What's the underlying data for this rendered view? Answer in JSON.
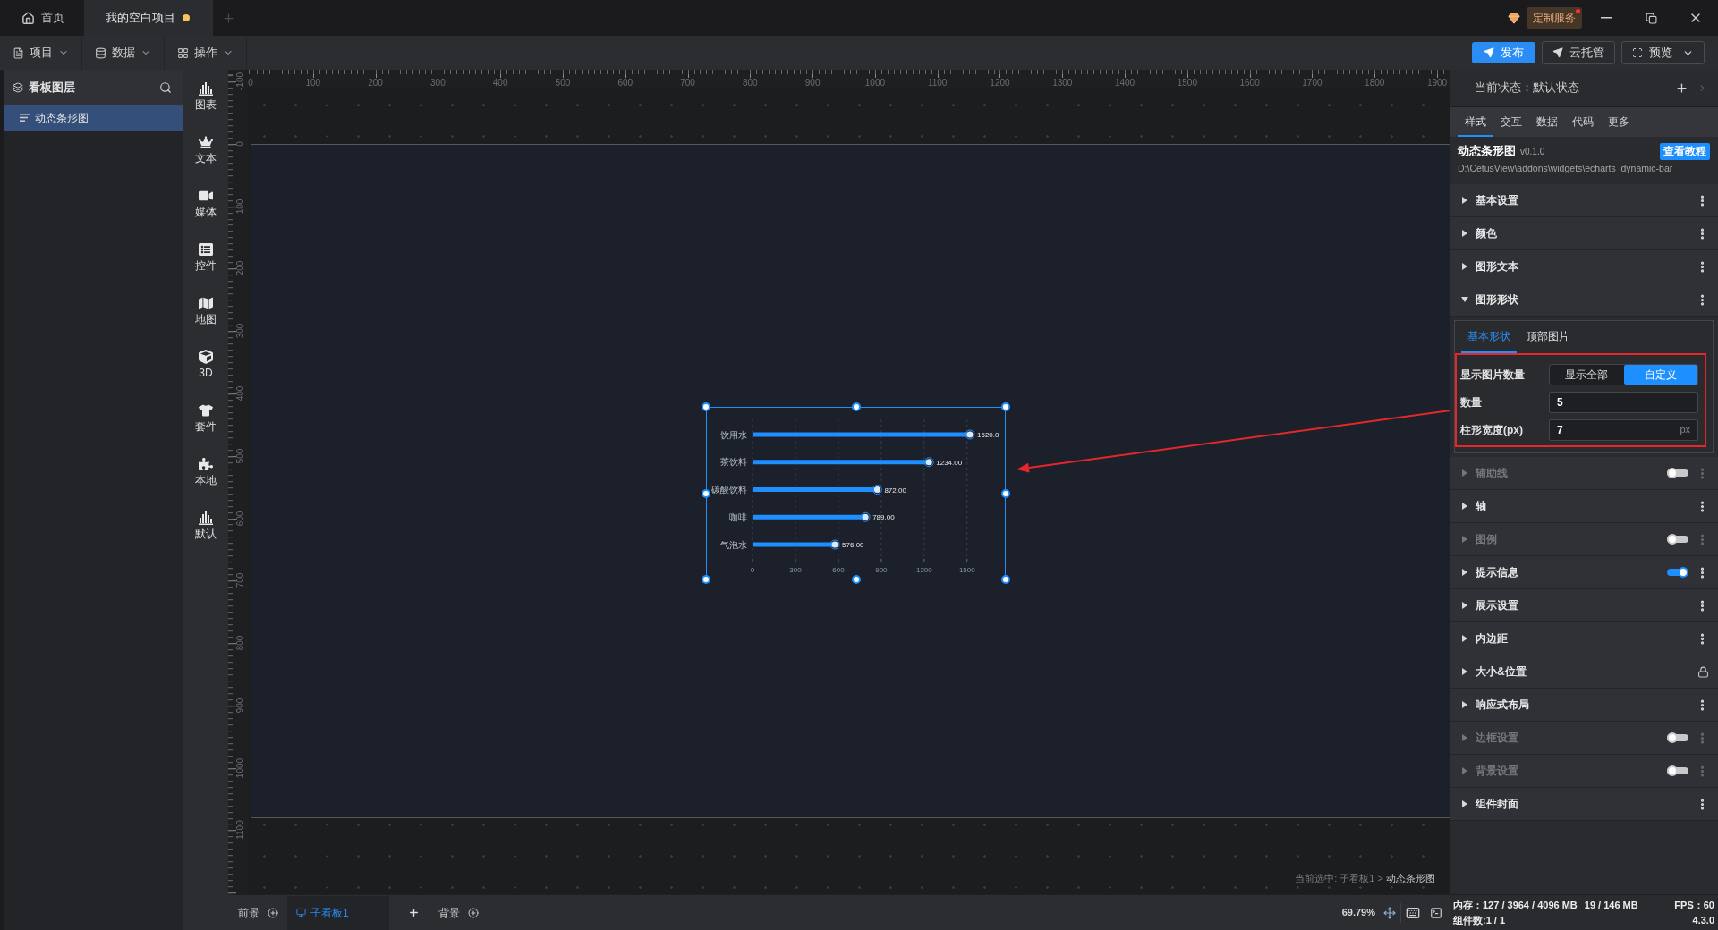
{
  "title_bar": {
    "tabs": [
      {
        "label": "首页",
        "selected": false,
        "modified": false
      },
      {
        "label": "我的空白项目",
        "selected": true,
        "modified": true
      }
    ],
    "service": {
      "label": "定制服务",
      "notification": true
    }
  },
  "toolbar": {
    "menus": [
      "项目",
      "数据",
      "操作"
    ],
    "actions": [
      {
        "label": "发布",
        "primary": true,
        "dropdown": false
      },
      {
        "label": "云托管",
        "primary": false,
        "dropdown": false
      },
      {
        "label": "预览",
        "primary": false,
        "dropdown": true
      }
    ]
  },
  "layers_panel": {
    "title": "看板图层",
    "items": [
      {
        "label": "动态条形图",
        "selected": true
      }
    ]
  },
  "widget_categories": [
    "图表",
    "文本",
    "媒体",
    "控件",
    "地图",
    "3D",
    "套件",
    "本地",
    "默认"
  ],
  "rulers": {
    "horizontal": [
      "0",
      "100",
      "200",
      "300",
      "400",
      "500",
      "600",
      "700",
      "800",
      "900",
      "1000",
      "1100",
      "1200",
      "1300",
      "1400",
      "1500",
      "1600",
      "1700",
      "1800",
      "1900"
    ],
    "vertical": [
      "-100",
      "0",
      "100",
      "200",
      "300",
      "400",
      "500",
      "600",
      "700",
      "800",
      "900",
      "1000",
      "1100"
    ]
  },
  "canvas": {
    "widget": {
      "selected": true,
      "chart_data": {
        "type": "bar",
        "orientation": "horizontal",
        "categories": [
          "饮用水",
          "茶饮料",
          "碳酸饮料",
          "咖啡",
          "气泡水"
        ],
        "values": [
          1520,
          1234,
          872,
          789,
          576
        ],
        "xlim": [
          0,
          1520
        ],
        "xticks": [
          0,
          300,
          600,
          900,
          1200,
          1500
        ],
        "grid": true,
        "value_labels": [
          "1520.0",
          "1234.00",
          "872.00",
          "789.00",
          "576.00"
        ]
      }
    },
    "selection_info": {
      "path": "当前选中: 子看板1 >",
      "current": "动态条形图"
    }
  },
  "bottom_bar": {
    "boards": [
      {
        "label": "前景",
        "kind": "layer",
        "selected": false
      },
      {
        "label": "子看板1",
        "kind": "board",
        "selected": true
      },
      {
        "label": "背景",
        "kind": "layer",
        "selected": false
      }
    ],
    "zoom": "69.79%"
  },
  "inspector": {
    "state": "当前状态：默认状态",
    "tabs": [
      {
        "label": "样式",
        "selected": true
      },
      {
        "label": "交互",
        "selected": false
      },
      {
        "label": "数据",
        "selected": false
      },
      {
        "label": "代码",
        "selected": false
      },
      {
        "label": "更多",
        "selected": false
      }
    ],
    "widget": {
      "name": "动态条形图",
      "version": "v0.1.0",
      "tutorial": "查看教程",
      "path": "D:\\CetusView\\addons\\widgets\\echarts_dynamic-bar"
    },
    "sections": [
      {
        "label": "基本设置",
        "kind": "menu",
        "expanded": false
      },
      {
        "label": "颜色",
        "kind": "menu",
        "expanded": false
      },
      {
        "label": "图形文本",
        "kind": "menu",
        "expanded": false
      },
      {
        "label": "图形形状",
        "kind": "menu",
        "expanded": true,
        "content": {
          "tabs": [
            {
              "label": "基本形状",
              "selected": true
            },
            {
              "label": "顶部图片",
              "selected": false
            }
          ],
          "fields": [
            {
              "kind": "segmented",
              "label": "显示图片数量",
              "options": [
                {
                  "label": "显示全部",
                  "selected": false
                },
                {
                  "label": "自定义",
                  "selected": true
                }
              ]
            },
            {
              "kind": "input",
              "label": "数量",
              "value": "5"
            },
            {
              "kind": "input",
              "label": "柱形宽度(px)",
              "value": "7",
              "unit": "px"
            }
          ]
        }
      },
      {
        "label": "辅助线",
        "kind": "toggle",
        "on": false,
        "expanded": false
      },
      {
        "label": "轴",
        "kind": "menu",
        "expanded": false
      },
      {
        "label": "图例",
        "kind": "toggle",
        "on": false,
        "expanded": false
      },
      {
        "label": "提示信息",
        "kind": "toggle",
        "on": true,
        "expanded": false
      },
      {
        "label": "展示设置",
        "kind": "menu",
        "expanded": false
      },
      {
        "label": "内边距",
        "kind": "menu",
        "expanded": false
      },
      {
        "label": "大小&位置",
        "kind": "lock",
        "expanded": false
      },
      {
        "label": "响应式布局",
        "kind": "menu",
        "expanded": false
      },
      {
        "label": "边框设置",
        "kind": "toggle",
        "on": false,
        "expanded": false
      },
      {
        "label": "背景设置",
        "kind": "toggle",
        "on": false,
        "expanded": false
      },
      {
        "label": "组件封面",
        "kind": "menu",
        "expanded": false
      }
    ]
  },
  "status_bar": {
    "memory": "内存：127 / 3964 / 4096 MB",
    "memory_2": "19 / 146 MB",
    "fps": "FPS：60",
    "components": "组件数:1 / 1",
    "version": "4.3.0"
  }
}
